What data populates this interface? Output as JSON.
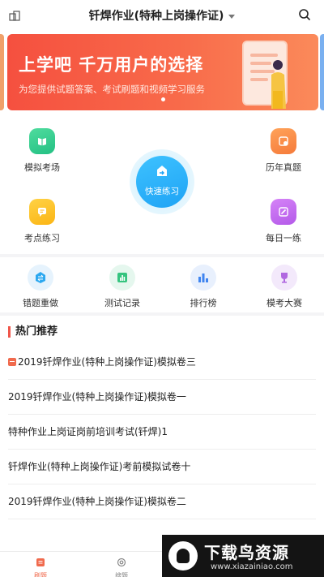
{
  "header": {
    "title": "钎焊作业(特种上岗操作证)"
  },
  "banner": {
    "headline": "上学吧  千万用户的选择",
    "subtitle": "为您提供试题答案、考试刷题和视频学习服务"
  },
  "tools": {
    "mock_exam": "模拟考场",
    "past_papers": "历年真题",
    "quick_practice": "快速练习",
    "topic_practice": "考点练习",
    "daily_practice": "每日一练"
  },
  "row2": {
    "wrong_redo": "错题重做",
    "test_records": "测试记录",
    "ranking": "排行榜",
    "mock_contest": "模考大赛"
  },
  "hot": {
    "heading": "热门推荐",
    "items": [
      "2019钎焊作业(特种上岗操作证)模拟卷三",
      "2019钎焊作业(特种上岗操作证)模拟卷一",
      "特种作业上岗证岗前培训考试(钎焊)1",
      "钎焊作业(特种上岗操作证)考前模拟试卷十",
      "2019钎焊作业(特种上岗操作证)模拟卷二"
    ]
  },
  "tabbar": {
    "tab1": "刷题",
    "tab2": "搜题"
  },
  "watermark": {
    "brand": "下载鸟资源",
    "url": "www.xiazainiao.com"
  },
  "colors": {
    "accent": "#f0564a",
    "quick": "#1ea3f5"
  }
}
